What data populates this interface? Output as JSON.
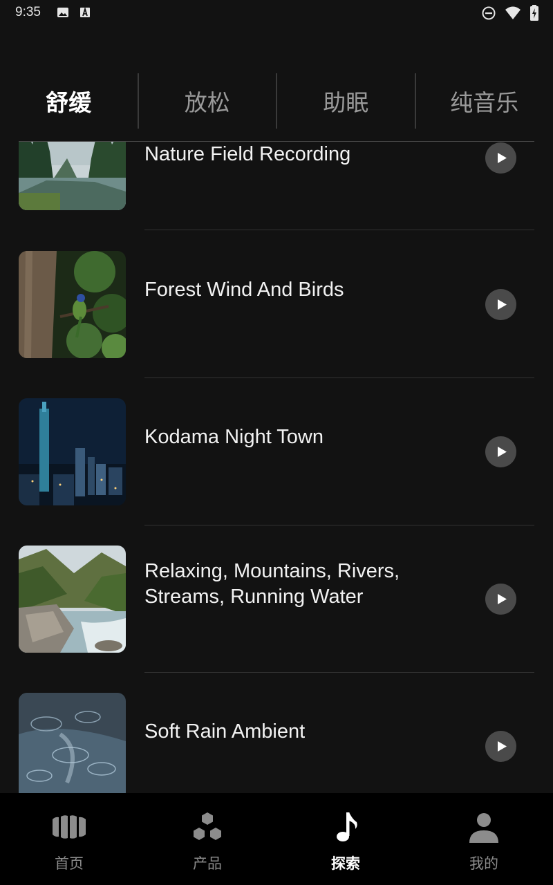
{
  "status_bar": {
    "time": "9:35",
    "left_icons": [
      "image-icon",
      "font-icon"
    ],
    "right_icons": [
      "do-not-disturb-icon",
      "wifi-icon",
      "battery-charging-icon"
    ]
  },
  "tabs": [
    {
      "label": "舒缓",
      "active": true
    },
    {
      "label": "放松",
      "active": false
    },
    {
      "label": "助眠",
      "active": false
    },
    {
      "label": "纯音乐",
      "active": false
    }
  ],
  "tracks": [
    {
      "title": "Nature Field Recording",
      "thumbnail": "forest-river-lake"
    },
    {
      "title": "Forest Wind And Birds",
      "thumbnail": "bird-on-tree"
    },
    {
      "title": "Kodama Night Town",
      "thumbnail": "night-city-skyline"
    },
    {
      "title": "Relaxing, Mountains, Rivers, Streams, Running Water",
      "thumbnail": "mountain-river-rocks"
    },
    {
      "title": "Soft Rain Ambient",
      "thumbnail": "rain-on-water"
    }
  ],
  "bottom_nav": [
    {
      "label": "首页",
      "icon": "home-shell-icon",
      "active": false
    },
    {
      "label": "产品",
      "icon": "hexagons-icon",
      "active": false
    },
    {
      "label": "探索",
      "icon": "music-note-icon",
      "active": true
    },
    {
      "label": "我的",
      "icon": "person-icon",
      "active": false
    }
  ],
  "colors": {
    "background": "#121212",
    "nav_background": "#000000",
    "play_button": "#4a4a4a",
    "inactive_text": "#9a9a9a"
  }
}
